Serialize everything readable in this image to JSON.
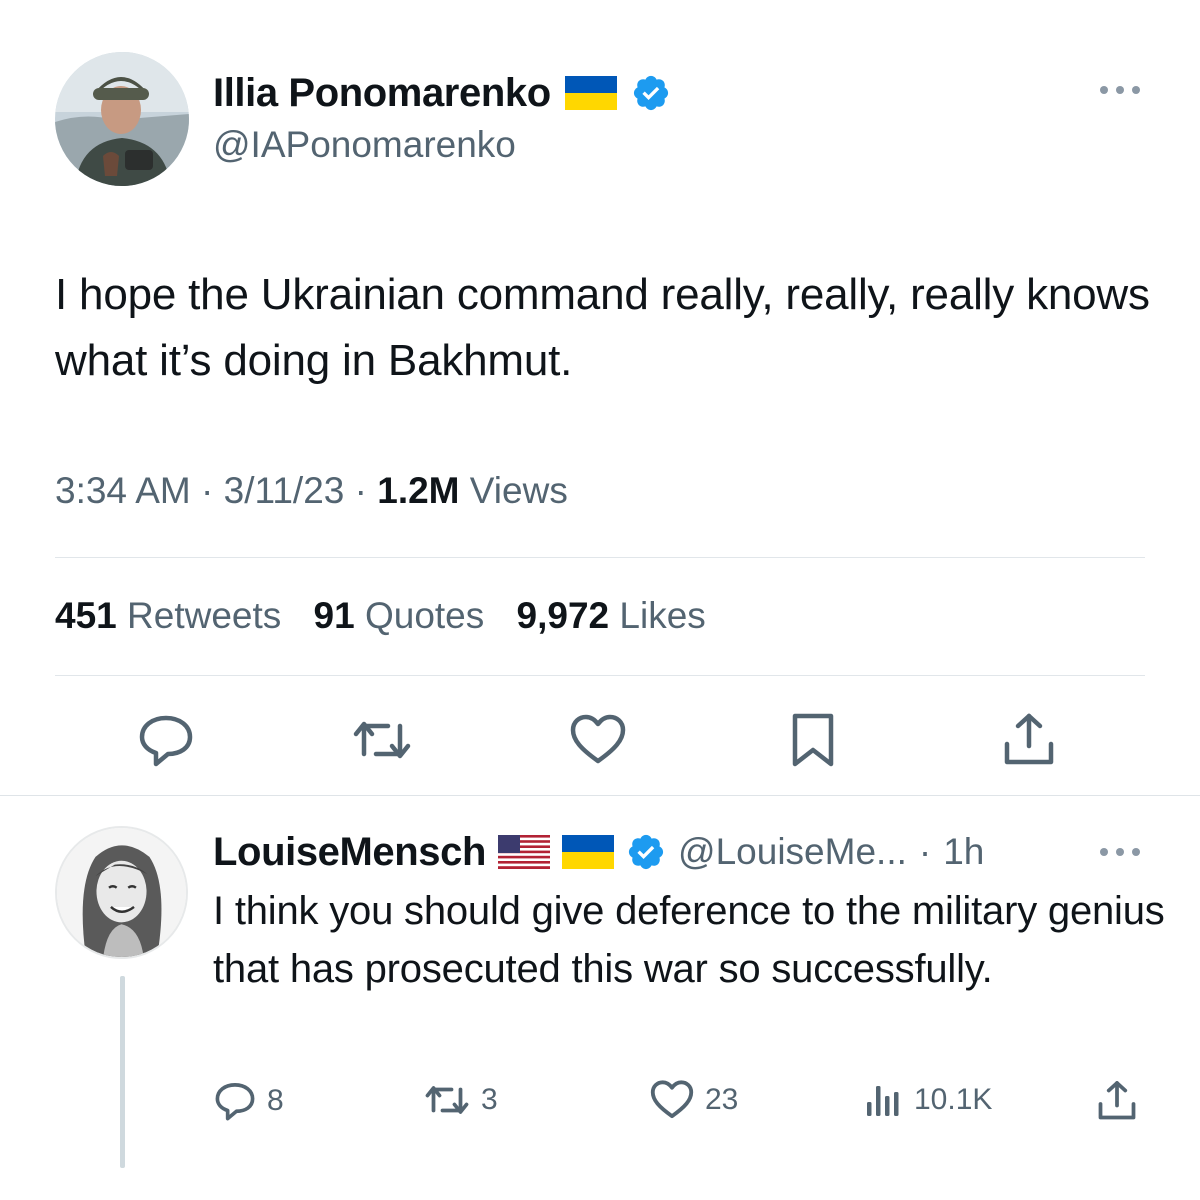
{
  "main_tweet": {
    "display_name": "Illia Ponomarenko",
    "handle": "@IAPonomarenko",
    "text": "I hope the Ukrainian command really, really, really knows what it’s doing in Bakhmut.",
    "time": "3:34 AM",
    "date": "3/11/23",
    "views_count": "1.2M",
    "views_label": "Views",
    "separator": "·",
    "stats": {
      "retweets_count": "451",
      "retweets_label": "Retweets",
      "quotes_count": "91",
      "quotes_label": "Quotes",
      "likes_count": "9,972",
      "likes_label": "Likes"
    },
    "actions": [
      "reply-icon",
      "retweet-icon",
      "like-icon",
      "bookmark-icon",
      "share-icon"
    ]
  },
  "reply": {
    "display_name": "LouiseMensch",
    "handle": "@LouiseMe...",
    "separator": "·",
    "time": "1h",
    "text": "I think you should give deference to the military genius that has prosecuted this war so successfully.",
    "replies": "8",
    "retweets": "3",
    "likes": "23",
    "views": "10.1K"
  },
  "colors": {
    "text": "#0f1419",
    "secondary": "#536471",
    "verified": "#1d9bf0",
    "divider": "#e1e6ea",
    "ukraine_blue": "#0057b7",
    "ukraine_yellow": "#ffd700"
  },
  "icons": [
    "verified-badge-icon",
    "ukraine-flag-icon",
    "us-flag-icon",
    "more-icon",
    "views-icon"
  ]
}
